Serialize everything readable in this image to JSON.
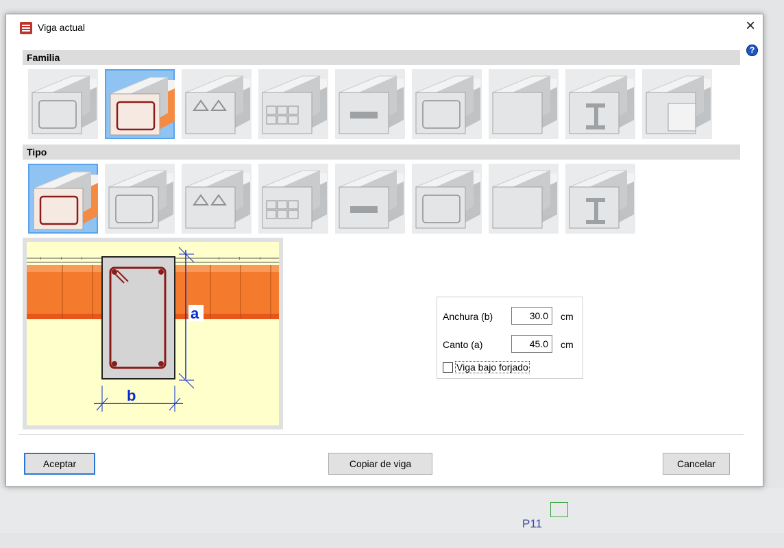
{
  "window": {
    "title": "Viga actual",
    "close_glyph": "×",
    "help_glyph": "?"
  },
  "familia": {
    "header": "Familia",
    "items": [
      {
        "icon": "beam-hollow-block-icon"
      },
      {
        "icon": "beam-reinforced-concrete-icon",
        "selected": true
      },
      {
        "icon": "beam-triangular-voids-icon"
      },
      {
        "icon": "beam-waffle-icon"
      },
      {
        "icon": "beam-precast-joists-icon"
      },
      {
        "icon": "beam-box-section-icon"
      },
      {
        "icon": "beam-plain-slab-icon"
      },
      {
        "icon": "beam-steel-i-icon"
      },
      {
        "icon": "beam-wall-block-icon"
      }
    ]
  },
  "tipo": {
    "header": "Tipo",
    "items": [
      {
        "icon": "type-rectangular-icon",
        "selected": true
      },
      {
        "icon": "type-narrow-icon"
      },
      {
        "icon": "type-wide-icon"
      },
      {
        "icon": "type-inverted-t-icon"
      },
      {
        "icon": "type-t-section-icon"
      },
      {
        "icon": "type-l-left-icon"
      },
      {
        "icon": "type-l-double-icon"
      },
      {
        "icon": "type-deep-icon"
      }
    ]
  },
  "preview": {
    "label_a": "a",
    "label_b": "b"
  },
  "dimensions": {
    "width_label": "Anchura (b)",
    "width_value": "30.0",
    "width_unit": "cm",
    "depth_label": "Canto (a)",
    "depth_value": "45.0",
    "depth_unit": "cm",
    "under_slab_label": "Viga bajo forjado",
    "under_slab_checked": false
  },
  "buttons": {
    "accept": "Aceptar",
    "copy": "Copiar de viga",
    "cancel": "Cancelar"
  },
  "background": {
    "node_label": "P11"
  },
  "colors": {
    "accent": "#2a76d4",
    "selected": "#8fc3f2",
    "brick": "#f47b2e",
    "rebar": "#8b1c1c",
    "dim_blue": "#0a2bd0"
  }
}
